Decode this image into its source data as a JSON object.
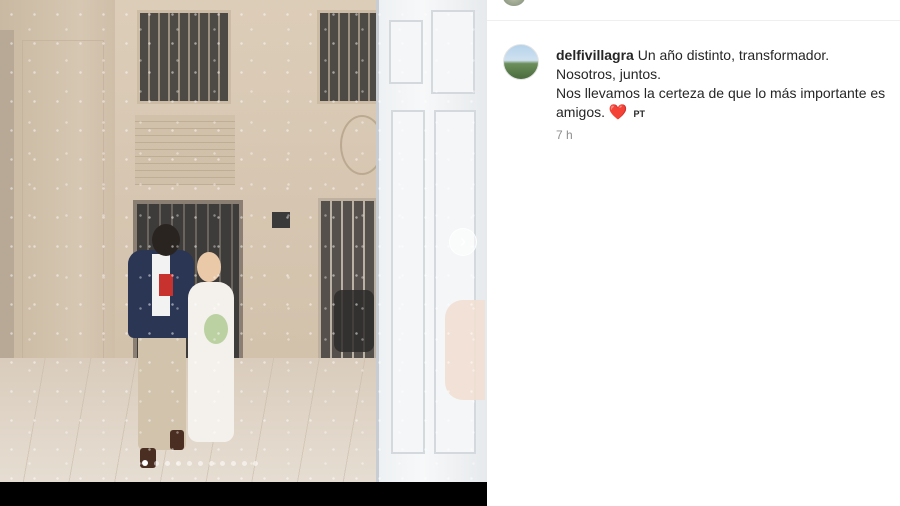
{
  "post": {
    "username": "delfivillagra",
    "caption_lines": [
      "Un año distinto, transformador.",
      "Nosotros, juntos.",
      "Nos llevamos la certeza de que lo más importante es",
      "amigos."
    ],
    "heart_emoji": "❤️",
    "language_tag": "PT",
    "timestamp": "7 h"
  },
  "carousel": {
    "next_icon": "chevron-right-icon",
    "next_glyph": "›",
    "total_slides": 11,
    "active_slide": 1
  },
  "colors": {
    "text": "#262626",
    "muted": "#8e8e8e",
    "heart": "#e02424",
    "background": "#ffffff"
  }
}
